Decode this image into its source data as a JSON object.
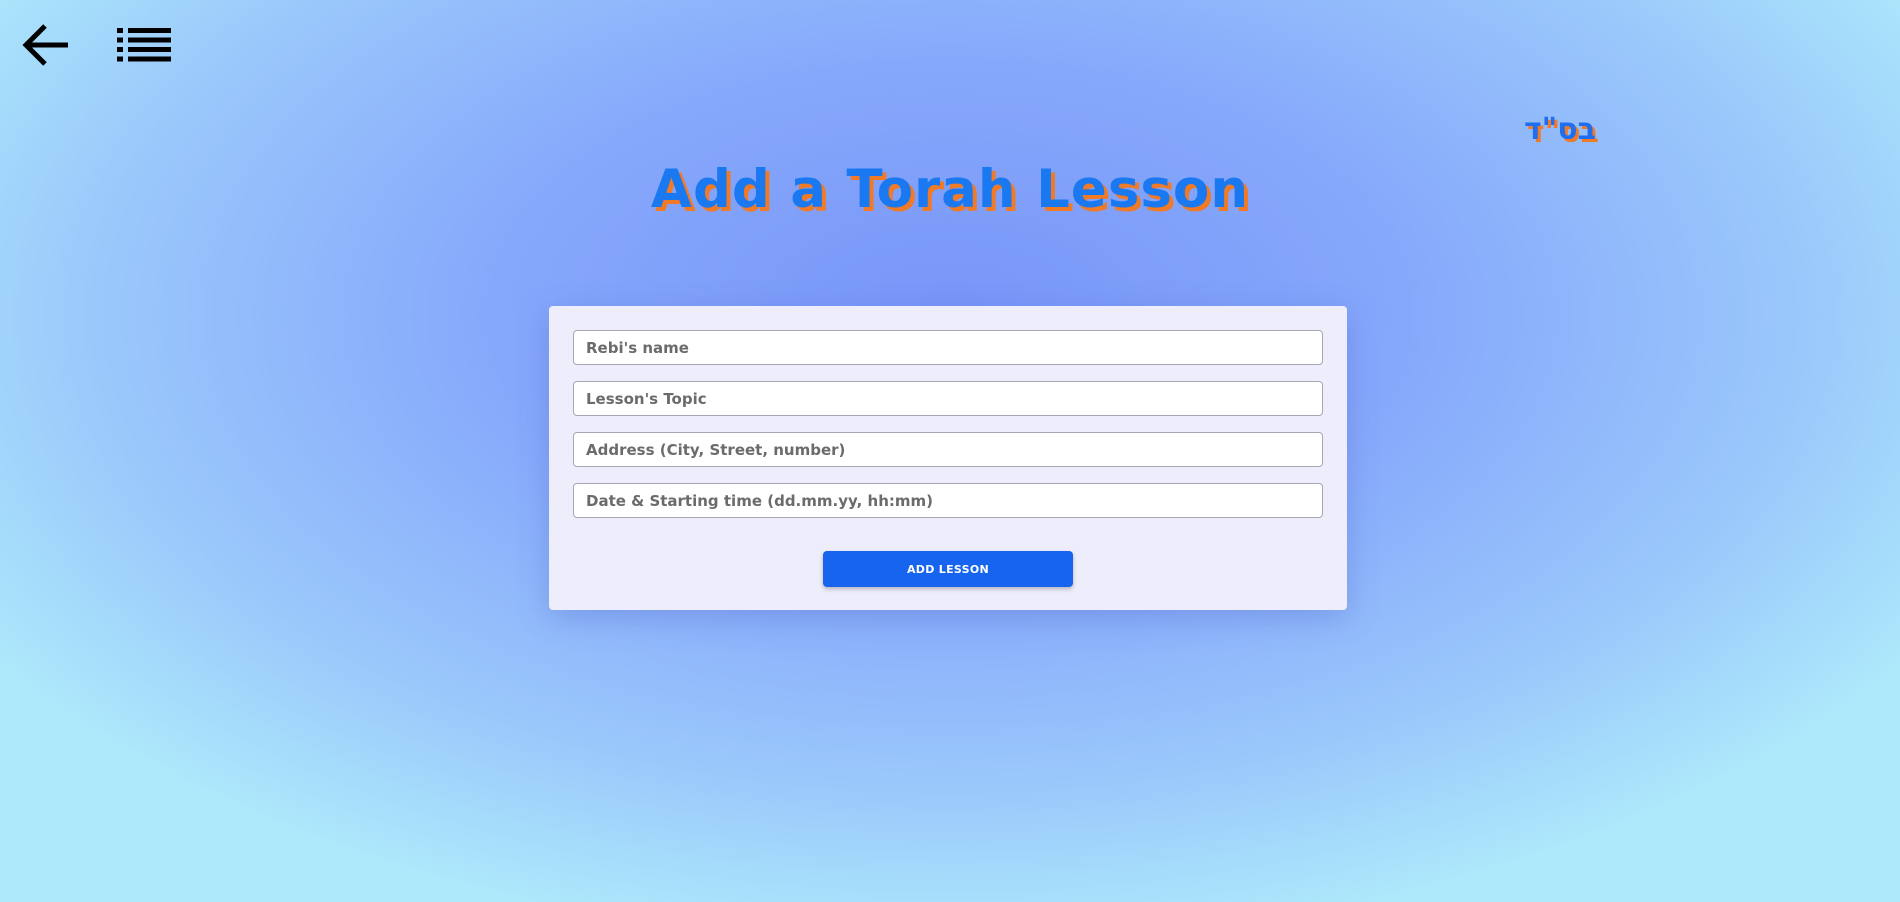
{
  "nav": {
    "back_icon": "arrow-left-icon",
    "menu_icon": "list-icon"
  },
  "header": {
    "bsd": "בס\"ד",
    "title": "Add a Torah Lesson"
  },
  "form": {
    "rebi_name_placeholder": "Rebi's name",
    "topic_placeholder": "Lesson's Topic",
    "address_placeholder": "Address (City, Street, number)",
    "datetime_placeholder": "Date & Starting time (dd.mm.yy, hh:mm)",
    "submit_label": "ADD LESSON"
  },
  "colors": {
    "title": "#1a78f0",
    "title_shadow": "#f07a26",
    "button": "#1765ef",
    "card": "#eeedfb"
  }
}
